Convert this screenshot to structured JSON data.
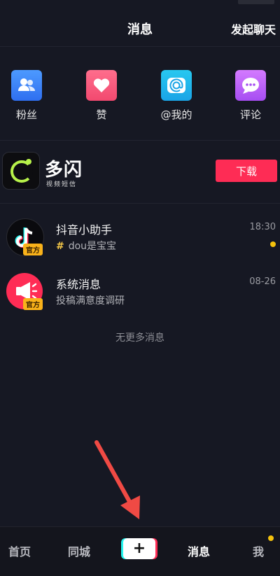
{
  "status_bar": {
    "left_text": "",
    "right_text": ""
  },
  "header": {
    "title": "消息",
    "start_chat": "发起聊天"
  },
  "shortcuts": [
    {
      "label": "粉丝",
      "icon": "users-icon"
    },
    {
      "label": "赞",
      "icon": "heart-icon"
    },
    {
      "label": "@我的",
      "icon": "at-icon"
    },
    {
      "label": "评论",
      "icon": "chat-bubble-icon"
    }
  ],
  "ad": {
    "brand": "多闪",
    "tagline": "视频短信",
    "button": "下载"
  },
  "messages": [
    {
      "name": "抖音小助手",
      "time": "18:30",
      "preview": "dou是宝宝",
      "badge": "官方",
      "unread": true
    },
    {
      "name": "系统消息",
      "time": "08-26",
      "preview": "投稿满意度调研",
      "badge": "官方",
      "unread": false
    }
  ],
  "footer_note": "无更多消息",
  "tabbar": {
    "home": "首页",
    "nearby": "同城",
    "plus": "+",
    "messages": "消息",
    "me": "我"
  },
  "colors": {
    "background": "#161823",
    "accent": "#fe2c55",
    "unread": "#f4c20d"
  }
}
